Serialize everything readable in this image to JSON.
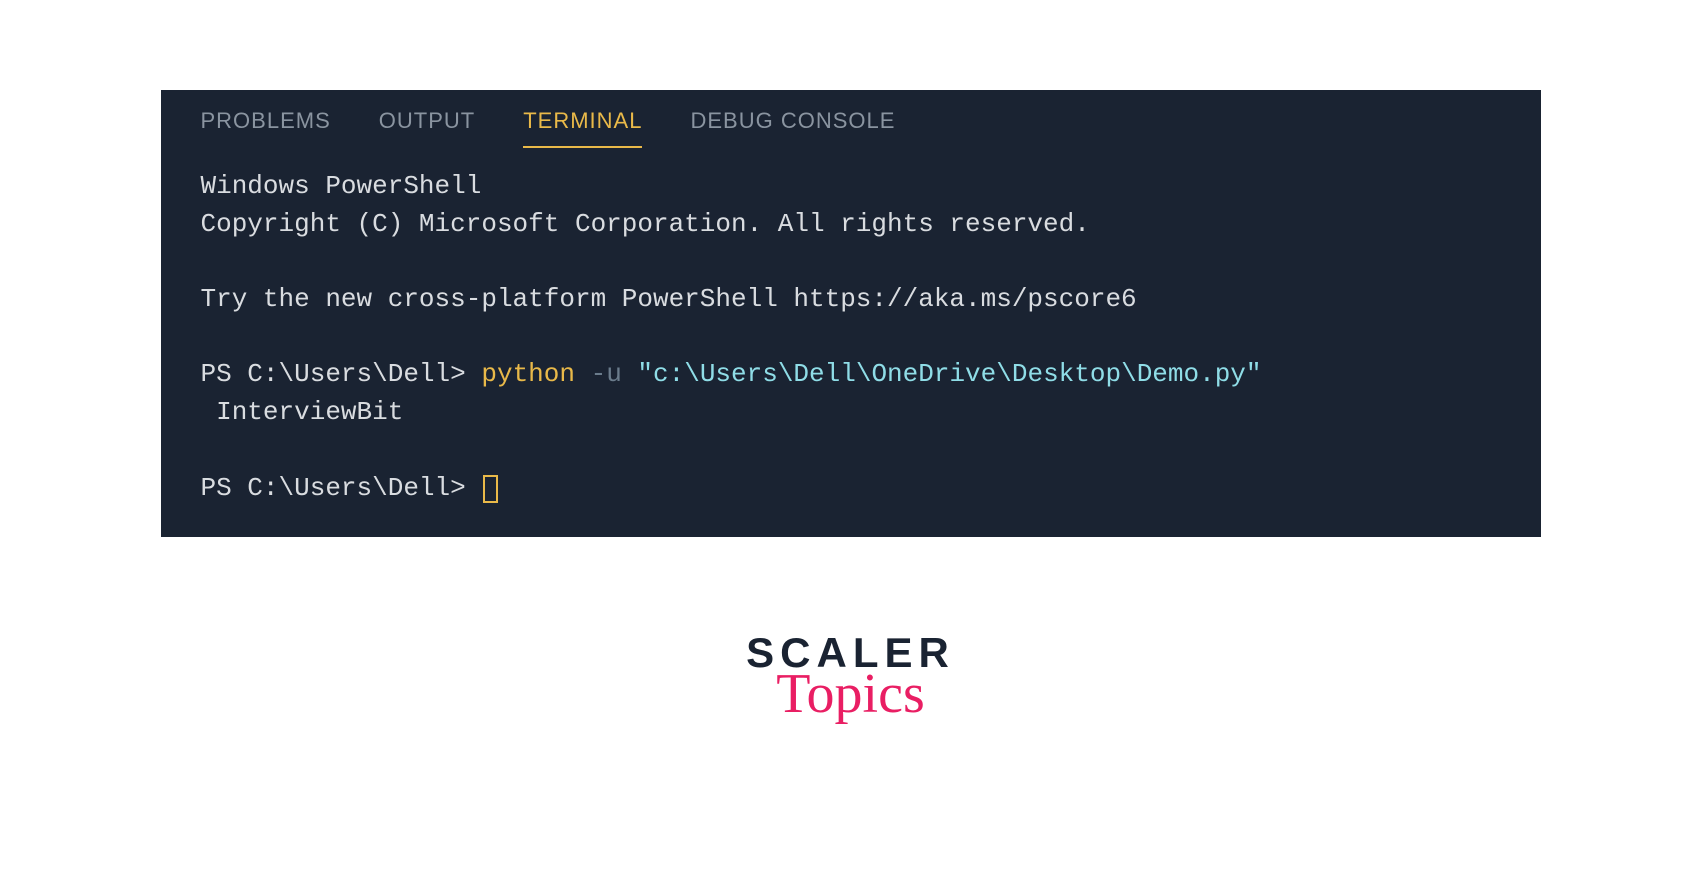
{
  "tabs": {
    "problems": "PROBLEMS",
    "output": "OUTPUT",
    "terminal": "TERMINAL",
    "debug": "DEBUG CONSOLE"
  },
  "terminal": {
    "header1": "Windows PowerShell",
    "header2": "Copyright (C) Microsoft Corporation. All rights reserved.",
    "try_msg": "Try the new cross-platform PowerShell https://aka.ms/pscore6",
    "prompt1_prefix": "PS C:\\Users\\Dell> ",
    "cmd_python": "python",
    "cmd_flag": " -u ",
    "cmd_path": "\"c:\\Users\\Dell\\OneDrive\\Desktop\\Demo.py\"",
    "output_line": " InterviewBit",
    "prompt2": "PS C:\\Users\\Dell> "
  },
  "logo": {
    "scaler": "SCALER",
    "topics": "Topics"
  }
}
